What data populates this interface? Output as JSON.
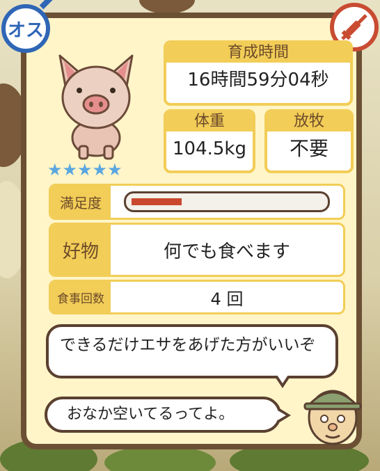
{
  "gender_badge": {
    "label": "オス",
    "color": "#2f66b6"
  },
  "vaccine_badge": {
    "icon": "no-syringe-icon",
    "color": "#c84b32"
  },
  "pig": {
    "stars": "★★★★★",
    "star_color": "#5aa6e0"
  },
  "growth_time": {
    "label": "育成時間",
    "value": "16時間59分04秒"
  },
  "weight": {
    "label": "体重",
    "value": "104.5kg"
  },
  "grazing": {
    "label": "放牧",
    "value": "不要"
  },
  "satisfaction": {
    "label": "満足度",
    "level": 0.27,
    "bar_color": "#c8472d"
  },
  "favorite_food": {
    "label": "好物",
    "value": "何でも食べます"
  },
  "meal_count": {
    "label": "食事回数",
    "value": "4 回"
  },
  "advice": {
    "text": "できるだけエサをあげた方がいいぞ"
  },
  "status_message": {
    "text": "おなか空いてるってよ。"
  },
  "colors": {
    "frame": "#6b5034",
    "panel": "#fff5c8",
    "accent": "#f2cd57"
  }
}
